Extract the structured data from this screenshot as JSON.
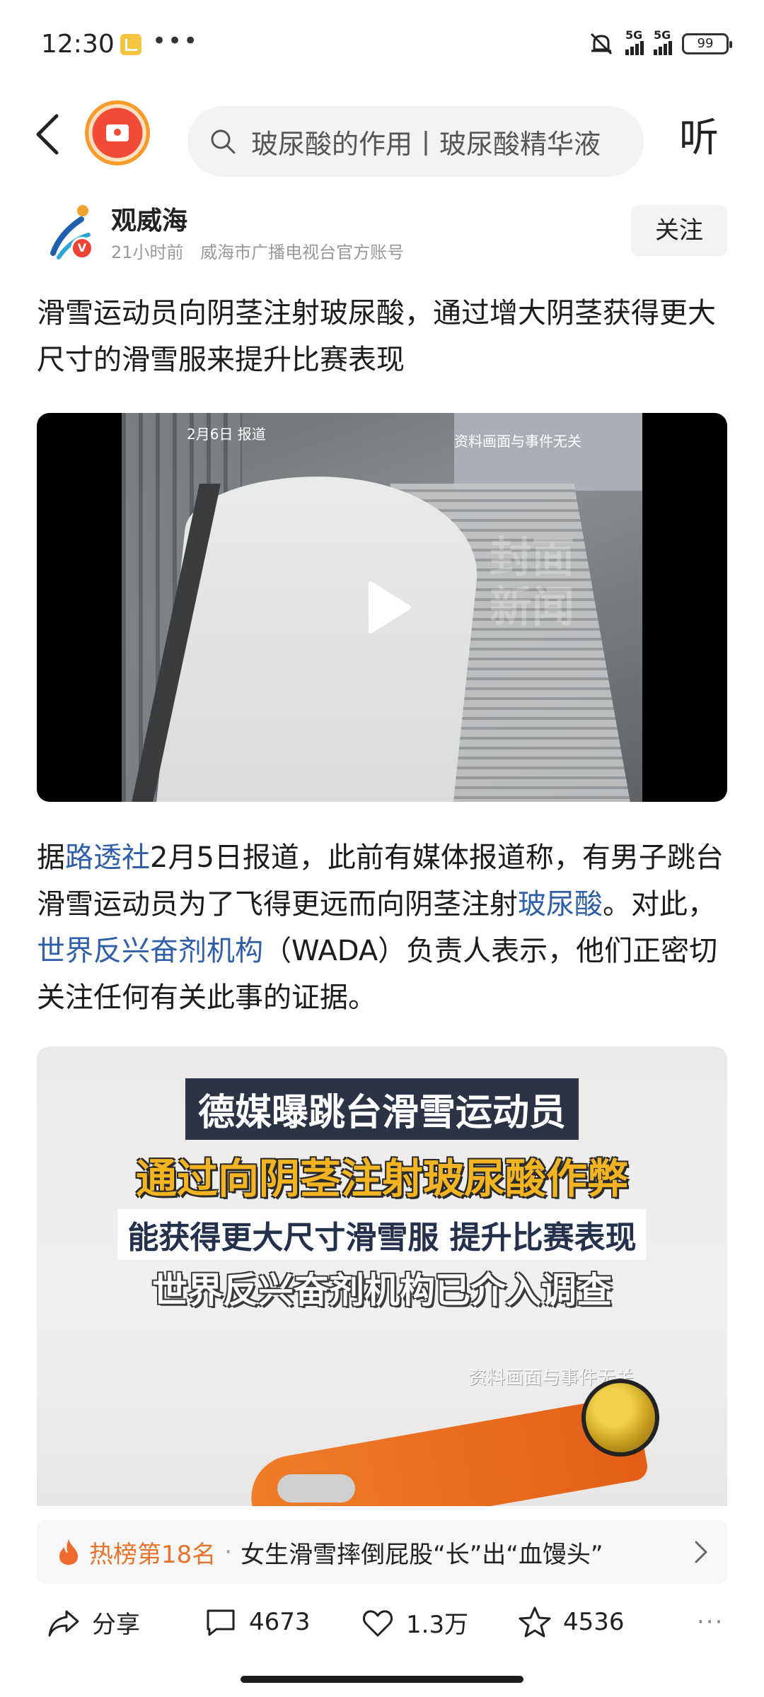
{
  "status_bar": {
    "time": "12:30",
    "more": "•••",
    "signal_1": "5G",
    "signal_2": "5G",
    "battery": "99"
  },
  "nav": {
    "search_placeholder": "玻尿酸的作用丨玻尿酸精华液",
    "listen_label": "听"
  },
  "author": {
    "name": "观威海",
    "time": "21小时前",
    "description": "威海市广播电视台官方账号",
    "follow_label": "关注",
    "verified": "V"
  },
  "article": {
    "title": "滑雪运动员向阴茎注射玻尿酸，通过增大阴茎获得更大尺寸的滑雪服来提升比赛表现",
    "paragraph": {
      "p1": "据",
      "link1": "路透社",
      "p2": "2月5日报道，此前有媒体报道称，有男子跳台滑雪运动员为了飞得更远而向阴茎注射",
      "link2": "玻尿酸",
      "p3": "。对此，",
      "link3": "世界反兴奋剂机构",
      "p4": "（WADA）负责人表示，他们正密切关注任何有关此事的证据。"
    }
  },
  "video": {
    "date_label": "2月6日 报道",
    "disclaimer": "资料画面与事件无关",
    "watermark": "封面新闻"
  },
  "image": {
    "caption_1": "德媒曝跳台滑雪运动员",
    "caption_2": "通过向阴茎注射玻尿酸作弊",
    "caption_3": "能获得更大尺寸滑雪服 提升比赛表现",
    "caption_4": "世界反兴奋剂机构已介入调查",
    "disclaimer": "资料画面与事件无关"
  },
  "hot_bar": {
    "rank": "热榜第18名",
    "separator": "·",
    "title": "女生滑雪摔倒屁股“长”出“血馒头”"
  },
  "actions": {
    "share": "分享",
    "comments": "4673",
    "likes": "1.3万",
    "favorites": "4536",
    "more": "···"
  },
  "colors": {
    "link": "#2f5fa8",
    "hot": "#e8742b",
    "accent_red": "#f04135"
  }
}
